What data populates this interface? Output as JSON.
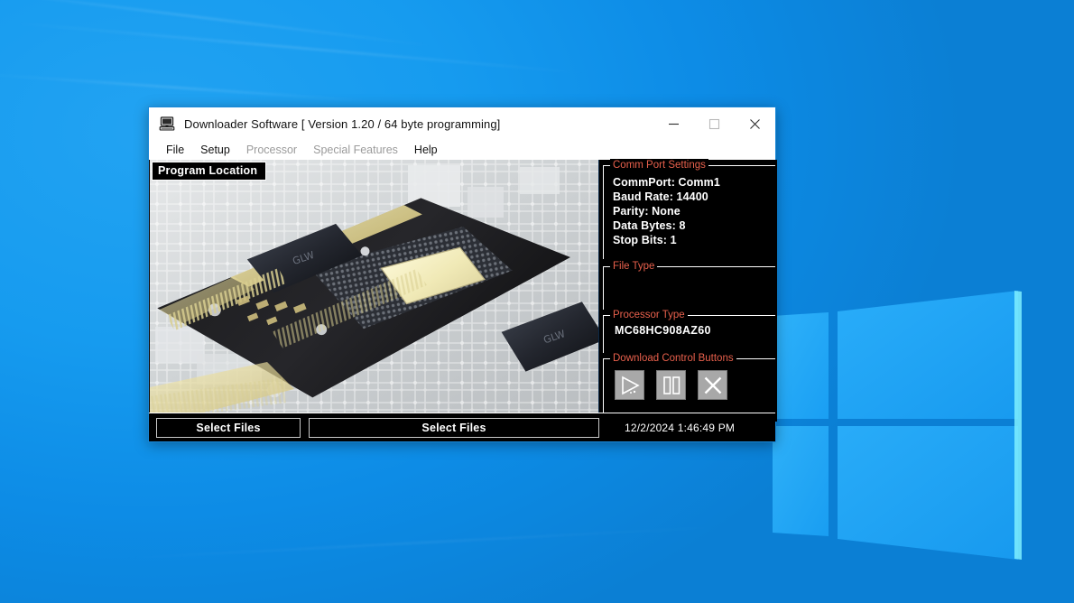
{
  "desktop": {
    "wallpaper": "windows-10-hero-blue",
    "accent_color": "#1ba1f2"
  },
  "window": {
    "title": "Downloader Software [ Version 1.20 / 64 byte programming]",
    "icon": "computer-icon",
    "controls": {
      "minimize": "minimize-icon",
      "maximize": "maximize-icon",
      "close": "close-icon"
    }
  },
  "menu": {
    "items": [
      {
        "label": "File",
        "disabled": false
      },
      {
        "label": "Setup",
        "disabled": false
      },
      {
        "label": "Processor",
        "disabled": true
      },
      {
        "label": "Special Features",
        "disabled": true
      },
      {
        "label": "Help",
        "disabled": false
      }
    ]
  },
  "image_panel": {
    "label": "Program Location",
    "content": "photograph of a cpu chip mounted on a computer motherboard"
  },
  "panels": {
    "comm_port": {
      "legend": "Comm Port Settings",
      "lines": [
        "CommPort: Comm1",
        "Baud Rate: 14400",
        "Parity: None",
        "Data Bytes: 8",
        "Stop Bits: 1"
      ]
    },
    "file_type": {
      "legend": "File Type",
      "value": ""
    },
    "processor_type": {
      "legend": "Processor Type",
      "value": "MC68HC908AZ60"
    },
    "download_controls": {
      "legend": "Download Control Buttons",
      "buttons": [
        {
          "icon": "play-triangle-icon",
          "name": "start-download-button"
        },
        {
          "icon": "pause-bars-icon",
          "name": "pause-download-button"
        },
        {
          "icon": "x-cross-icon",
          "name": "stop-download-button"
        }
      ]
    }
  },
  "bottom_bar": {
    "select_files_1": "Select Files",
    "select_files_2": "Select Files",
    "timestamp": "12/2/2024 1:46:49 PM"
  },
  "colors": {
    "legend_text": "#e8604c",
    "panel_background": "#000000",
    "panel_border": "#ffffff",
    "value_text": "#ffffff"
  }
}
